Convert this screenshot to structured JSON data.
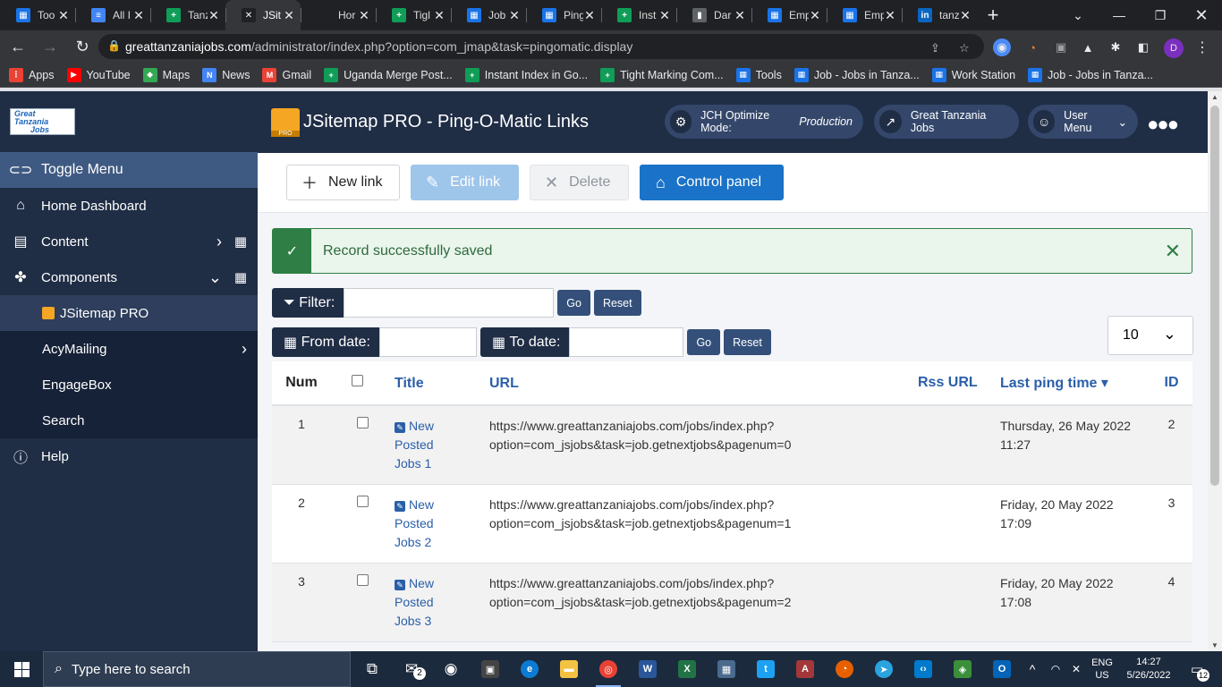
{
  "browser": {
    "tabs": [
      {
        "title": "Too",
        "favicon_color": "#1a73e8",
        "glyph": "▦"
      },
      {
        "title": "All I",
        "favicon_color": "#4285f4",
        "glyph": "≡"
      },
      {
        "title": "Tanz",
        "favicon_color": "#0f9d58",
        "glyph": "+"
      },
      {
        "title": "JSit",
        "favicon_color": "#202124",
        "glyph": "✕",
        "active": true
      },
      {
        "title": "Hor",
        "favicon_color": "#202124",
        "glyph": ""
      },
      {
        "title": "Tigl",
        "favicon_color": "#0f9d58",
        "glyph": "+"
      },
      {
        "title": "Job",
        "favicon_color": "#1a73e8",
        "glyph": "▦"
      },
      {
        "title": "Ping",
        "favicon_color": "#1a73e8",
        "glyph": "▦"
      },
      {
        "title": "Inst",
        "favicon_color": "#0f9d58",
        "glyph": "+"
      },
      {
        "title": "Dar",
        "favicon_color": "#5f6368",
        "glyph": "▮"
      },
      {
        "title": "Emp",
        "favicon_color": "#1a73e8",
        "glyph": "▦"
      },
      {
        "title": "Emp",
        "favicon_color": "#1a73e8",
        "glyph": "▦"
      },
      {
        "title": "tanz",
        "favicon_color": "#0a66c2",
        "glyph": "in"
      }
    ],
    "new_tab": "+",
    "url_host": "greattanzaniajobs.com",
    "url_path": "/administrator/index.php?option=com_jmap&task=pingomatic.display",
    "profile_initial": "D",
    "bookmarks": [
      {
        "label": "Apps",
        "color": "#ea4335",
        "glyph": "⋮"
      },
      {
        "label": "YouTube",
        "color": "#ff0000",
        "glyph": "▶"
      },
      {
        "label": "Maps",
        "color": "#34a853",
        "glyph": "◆"
      },
      {
        "label": "News",
        "color": "#4285f4",
        "glyph": "N"
      },
      {
        "label": "Gmail",
        "color": "#ea4335",
        "glyph": "M"
      },
      {
        "label": "Uganda Merge Post...",
        "color": "#0f9d58",
        "glyph": "+"
      },
      {
        "label": "Instant Index in Go...",
        "color": "#0f9d58",
        "glyph": "+"
      },
      {
        "label": "Tight Marking Com...",
        "color": "#0f9d58",
        "glyph": "+"
      },
      {
        "label": "Tools",
        "color": "#1a73e8",
        "glyph": "▦"
      },
      {
        "label": "Job - Jobs in Tanza...",
        "color": "#1a73e8",
        "glyph": "▦"
      },
      {
        "label": "Work Station",
        "color": "#1a73e8",
        "glyph": "▦"
      },
      {
        "label": "Job - Jobs in Tanza...",
        "color": "#1a73e8",
        "glyph": "▦"
      }
    ]
  },
  "sidebar": {
    "logo_line1": "Great",
    "logo_line2": "Tanzania",
    "logo_line3": "Jobs",
    "toggle": "Toggle Menu",
    "home": "Home Dashboard",
    "content": "Content",
    "components": "Components",
    "jsitemap": "JSitemap PRO",
    "acymailing": "AcyMailing",
    "engagebox": "EngageBox",
    "search": "Search",
    "help": "Help"
  },
  "header": {
    "title": "JSitemap PRO - Ping-O-Matic Links",
    "jch_label": "JCH Optimize Mode: ",
    "jch_mode": "Production",
    "site_link": "Great Tanzania Jobs",
    "user_menu": "User Menu"
  },
  "toolbar": {
    "new_link": "New link",
    "edit_link": "Edit link",
    "delete": "Delete",
    "control_panel": "Control panel"
  },
  "alert": {
    "message": "Record successfully saved"
  },
  "filters": {
    "filter_label": "Filter:",
    "from_label": "From date:",
    "to_label": "To date:",
    "go": "Go",
    "reset": "Reset",
    "limit": "10"
  },
  "table": {
    "headers": {
      "num": "Num",
      "title": "Title",
      "url": "URL",
      "rss": "Rss URL",
      "ping": "Last ping time",
      "id": "ID"
    },
    "rows": [
      {
        "num": "1",
        "title_1": "New",
        "title_2": "Posted",
        "title_3": "Jobs 1",
        "url_1": "https://www.greattanzaniajobs.com/jobs/index.php?",
        "url_2": "option=com_jsjobs&task=job.getnextjobs&pagenum=0",
        "ping_1": "Thursday, 26 May 2022",
        "ping_2": "11:27",
        "id": "2"
      },
      {
        "num": "2",
        "title_1": "New",
        "title_2": "Posted",
        "title_3": "Jobs 2",
        "url_1": "https://www.greattanzaniajobs.com/jobs/index.php?",
        "url_2": "option=com_jsjobs&task=job.getnextjobs&pagenum=1",
        "ping_1": "Friday, 20 May 2022",
        "ping_2": "17:09",
        "id": "3"
      },
      {
        "num": "3",
        "title_1": "New",
        "title_2": "Posted",
        "title_3": "Jobs 3",
        "url_1": "https://www.greattanzaniajobs.com/jobs/index.php?",
        "url_2": "option=com_jsjobs&task=job.getnextjobs&pagenum=2",
        "ping_1": "Friday, 20 May 2022",
        "ping_2": "17:08",
        "id": "4"
      }
    ]
  },
  "taskbar": {
    "search_placeholder": "Type here to search",
    "mail_badge": "2",
    "lang_1": "ENG",
    "lang_2": "US",
    "time": "14:27",
    "date": "5/26/2022",
    "notif_count": "12"
  }
}
